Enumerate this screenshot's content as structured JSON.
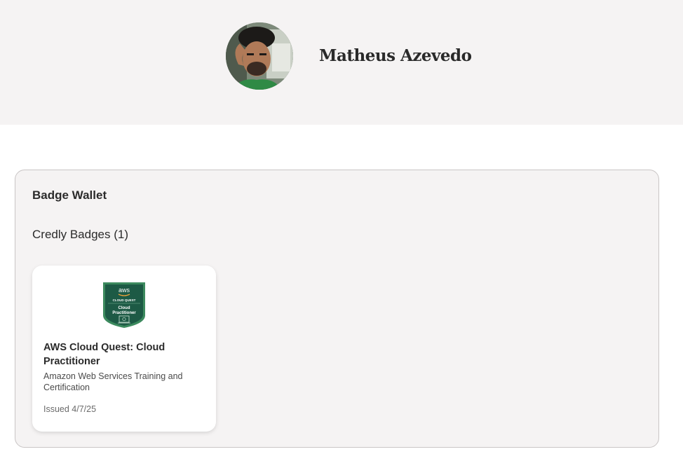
{
  "profile": {
    "name": "Matheus Azevedo",
    "avatar_alt": "profile-photo"
  },
  "wallet": {
    "title": "Badge Wallet",
    "subtitle": "Credly Badges (1)",
    "badges": [
      {
        "name": "AWS Cloud Quest: Cloud Practitioner",
        "issuer": "Amazon Web Services Training and Certification",
        "issued": "Issued 4/7/25",
        "image_text": {
          "logo": "aws",
          "program": "CLOUD QUEST",
          "line1": "Cloud",
          "line2": "Practitioner"
        },
        "colors": {
          "shield": "#1d5a45",
          "border": "#3c8a5e"
        }
      }
    ]
  }
}
